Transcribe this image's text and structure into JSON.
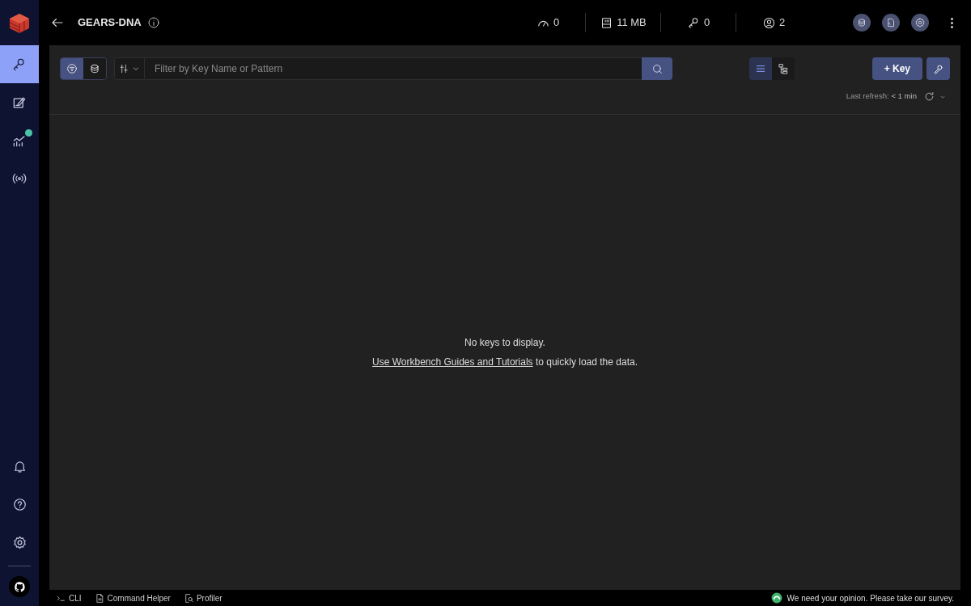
{
  "sidebar": {
    "nav": [
      {
        "kind": "keys",
        "selected": true,
        "badge": false
      },
      {
        "kind": "workbench",
        "selected": false,
        "badge": false
      },
      {
        "kind": "analysis",
        "selected": false,
        "badge": true
      },
      {
        "kind": "pubsub",
        "selected": false,
        "badge": false
      }
    ],
    "bottom": [
      {
        "kind": "bell"
      },
      {
        "kind": "help"
      },
      {
        "kind": "settings"
      },
      {
        "kind": "github"
      }
    ]
  },
  "header": {
    "title": "GEARS-DNA",
    "stats": [
      {
        "kind": "ops",
        "value": "0"
      },
      {
        "kind": "memory",
        "value": "11 MB"
      },
      {
        "kind": "keys",
        "value": "0"
      },
      {
        "kind": "clients",
        "value": "2"
      }
    ]
  },
  "toolbar": {
    "search_modes": [
      {
        "kind": "filter",
        "selected": true
      },
      {
        "kind": "database",
        "selected": false
      }
    ],
    "filter": {
      "placeholder": "Filter by Key Name or Pattern"
    },
    "views": [
      {
        "kind": "list",
        "selected": true
      },
      {
        "kind": "tree",
        "selected": false
      }
    ],
    "add_button": "+ Key",
    "last_refresh_label": "Last refresh:",
    "last_refresh_value": "< 1 min"
  },
  "empty": {
    "title": "No keys to display.",
    "link": "Use Workbench Guides and Tutorials",
    "rest": " to quickly load the data."
  },
  "bottom_bar": {
    "tools": [
      {
        "kind": "cli",
        "label": "CLI"
      },
      {
        "kind": "helper",
        "label": "Command Helper"
      },
      {
        "kind": "profiler",
        "label": "Profiler"
      }
    ],
    "survey": "We need your opinion. Please take our survey."
  }
}
